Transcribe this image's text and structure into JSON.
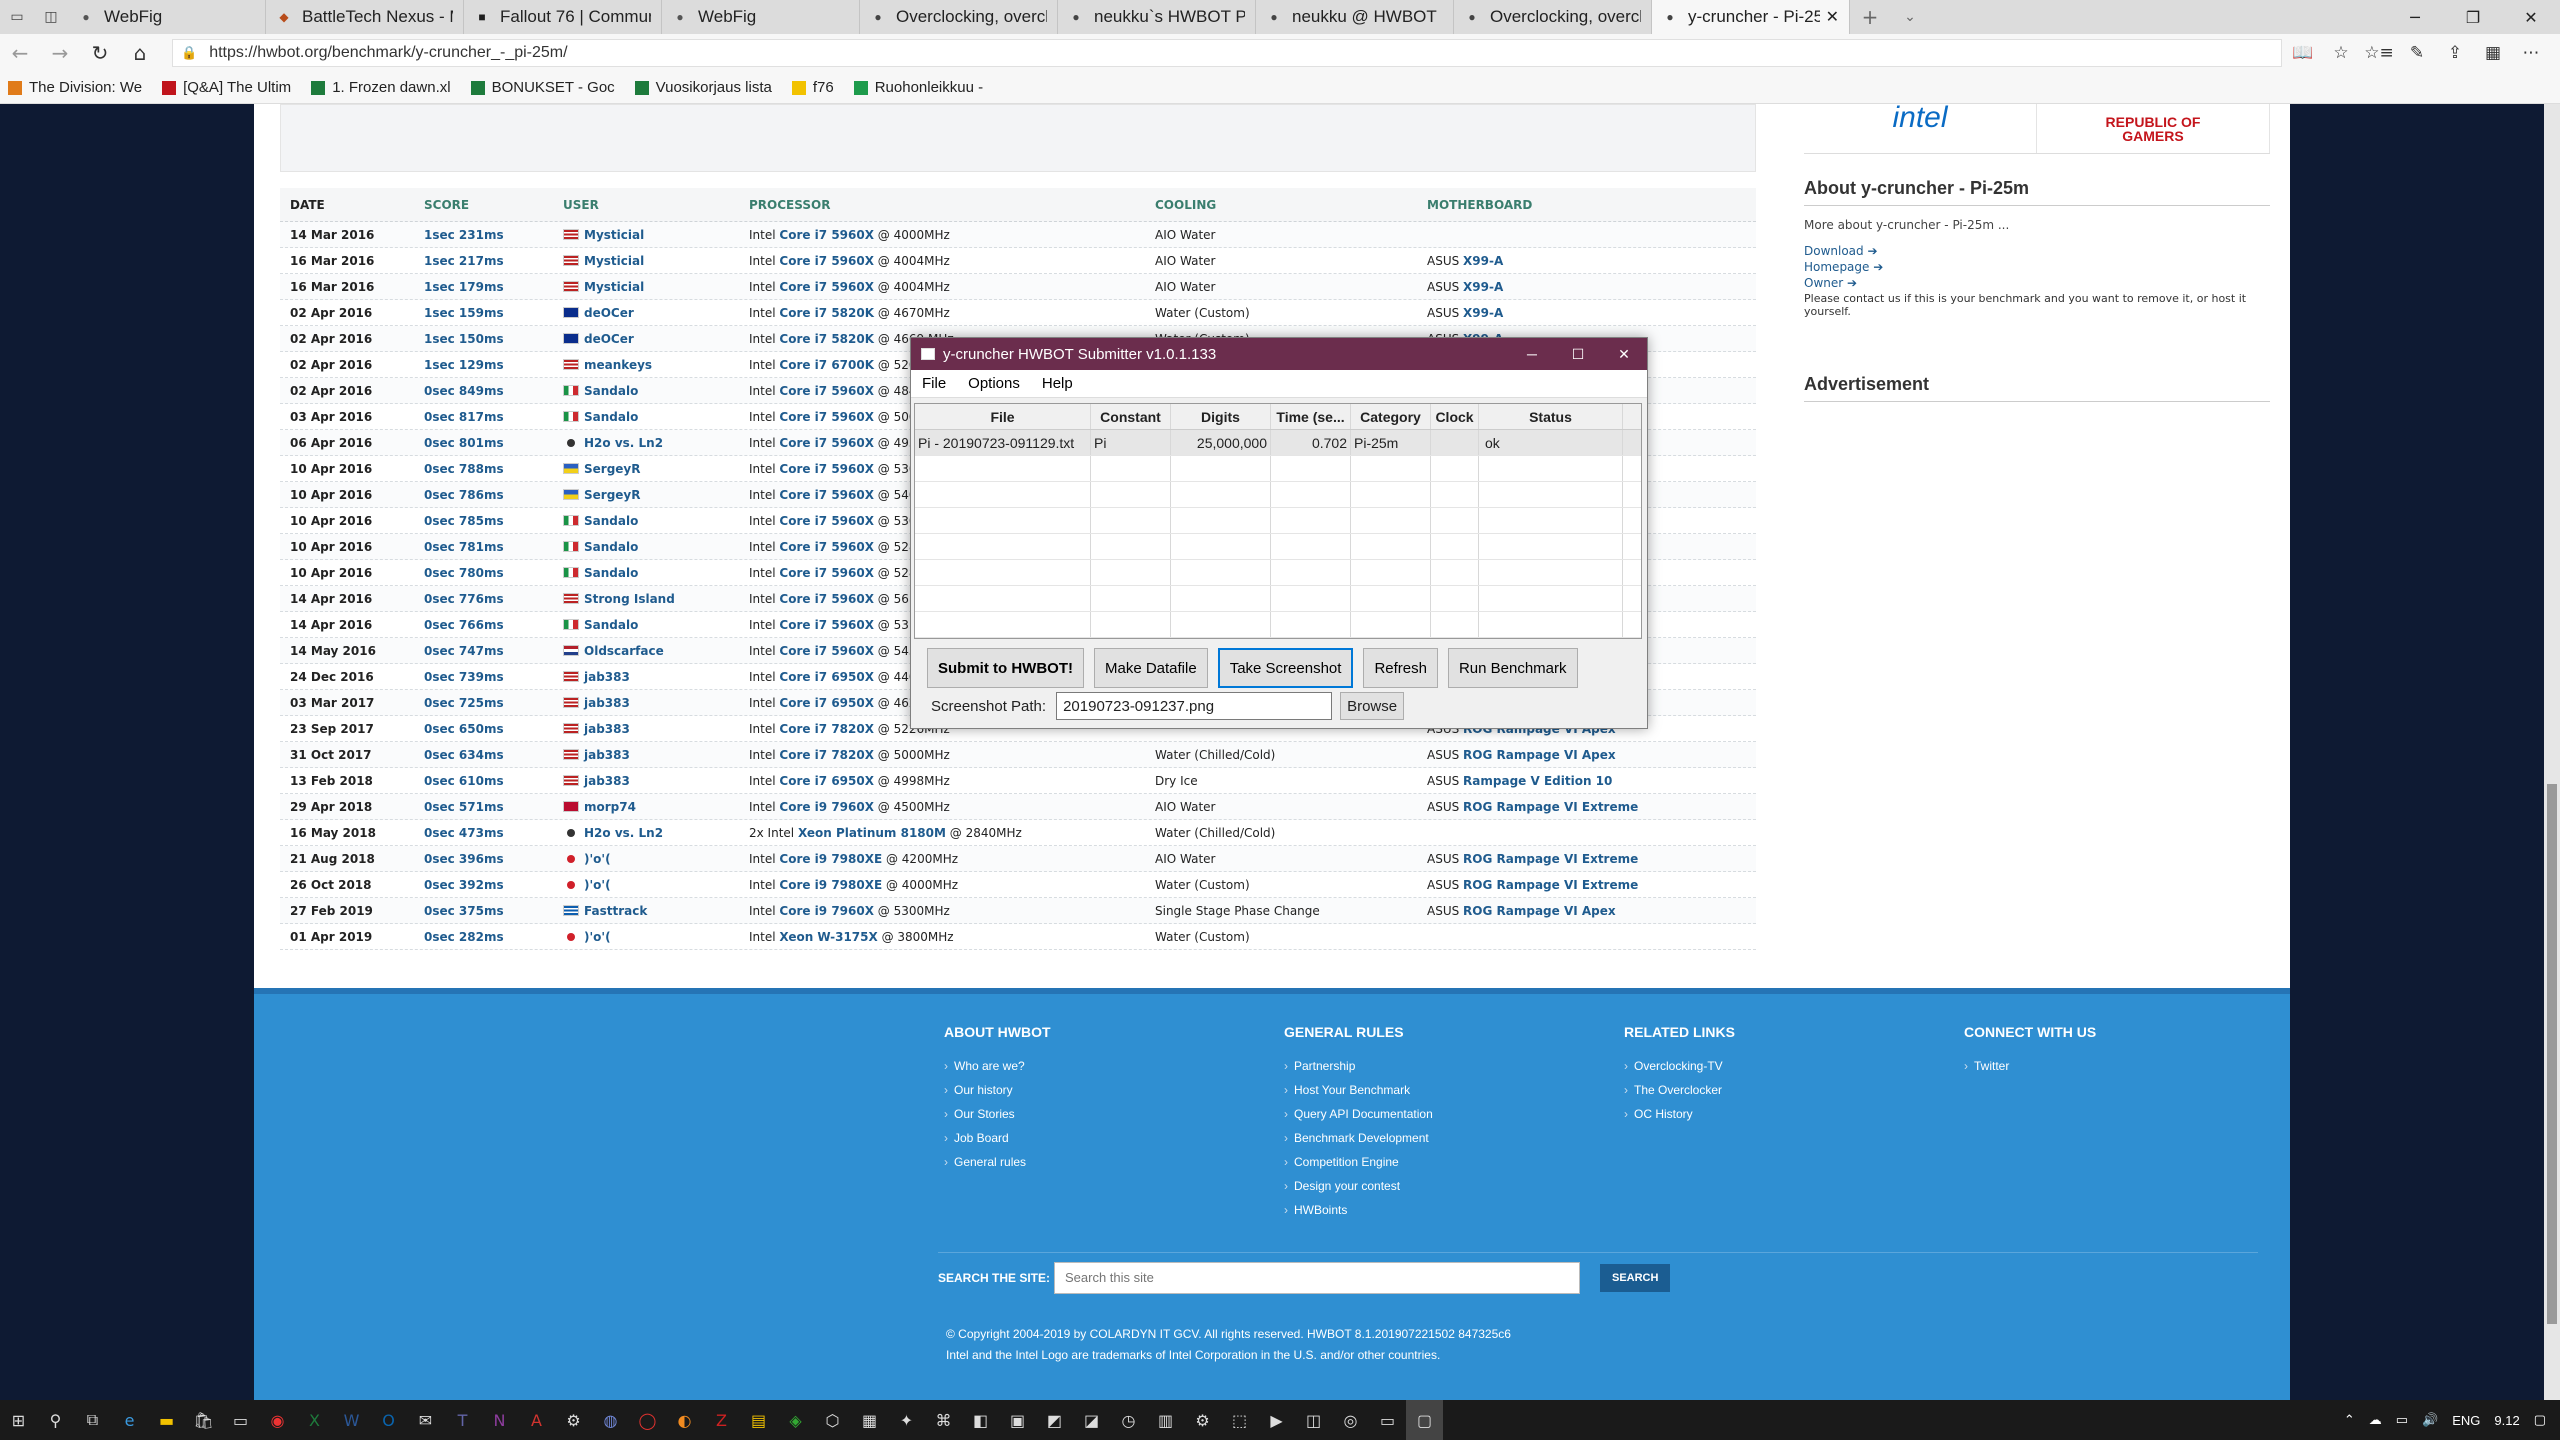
{
  "browser": {
    "tabs": [
      {
        "title": "WebFig",
        "icon": "webfig"
      },
      {
        "title": "BattleTech Nexus - Mo",
        "icon": "nexus"
      },
      {
        "title": "Fallout 76 | Community",
        "icon": "fallout"
      },
      {
        "title": "WebFig",
        "icon": "webfig"
      },
      {
        "title": "Overclocking, overcloc",
        "icon": "hwbot"
      },
      {
        "title": "neukku`s HWBOT Prim",
        "icon": "hwbot"
      },
      {
        "title": "neukku @ HWBOT",
        "icon": "hwbot"
      },
      {
        "title": "Overclocking, overcloc",
        "icon": "hwbot"
      },
      {
        "title": "y-cruncher - Pi-25m",
        "icon": "hwbot",
        "active": true
      }
    ],
    "url": "https://hwbot.org/benchmark/y-cruncher_-_pi-25m/",
    "favorites": [
      {
        "label": "The Division: We",
        "color": "#e07b1a"
      },
      {
        "label": "[Q&A] The Ultim",
        "color": "#c0141c"
      },
      {
        "label": "1. Frozen dawn.xl",
        "color": "#1e7b3c"
      },
      {
        "label": "BONUKSET - Goc",
        "color": "#1e7b3c"
      },
      {
        "label": "Vuosikorjaus lista",
        "color": "#1e7b3c"
      },
      {
        "label": "f76",
        "color": "#f2c200"
      },
      {
        "label": "Ruohonleikkuu -",
        "color": "#1e9b4c"
      }
    ]
  },
  "results": {
    "headers": {
      "date": "DATE",
      "score": "SCORE",
      "user": "USER",
      "processor": "PROCESSOR",
      "cooling": "COOLING",
      "motherboard": "MOTHERBOARD"
    },
    "rows": [
      {
        "date": "14 Mar 2016",
        "score": "1sec 231ms",
        "user": "Mysticial",
        "flag": "us",
        "cpu_pre": "Intel ",
        "cpu": "Core i7 5960X",
        "cpu_post": " @ 4000MHz",
        "cooling": "AIO Water",
        "mb_pre": "",
        "mb": ""
      },
      {
        "date": "16 Mar 2016",
        "score": "1sec 217ms",
        "user": "Mysticial",
        "flag": "us",
        "cpu_pre": "Intel ",
        "cpu": "Core i7 5960X",
        "cpu_post": " @ 4004MHz",
        "cooling": "AIO Water",
        "mb_pre": "ASUS ",
        "mb": "X99-A"
      },
      {
        "date": "16 Mar 2016",
        "score": "1sec 179ms",
        "user": "Mysticial",
        "flag": "us",
        "cpu_pre": "Intel ",
        "cpu": "Core i7 5960X",
        "cpu_post": " @ 4004MHz",
        "cooling": "AIO Water",
        "mb_pre": "ASUS ",
        "mb": "X99-A"
      },
      {
        "date": "02 Apr 2016",
        "score": "1sec 159ms",
        "user": "deOCer",
        "flag": "eu",
        "cpu_pre": "Intel ",
        "cpu": "Core i7 5820K",
        "cpu_post": " @ 4670MHz",
        "cooling": "Water (Custom)",
        "mb_pre": "ASUS ",
        "mb": "X99-A"
      },
      {
        "date": "02 Apr 2016",
        "score": "1sec 150ms",
        "user": "deOCer",
        "flag": "eu",
        "cpu_pre": "Intel ",
        "cpu": "Core i7 5820K",
        "cpu_post": " @ 4669 MHz",
        "cooling": "Water (Custom)",
        "mb_pre": "ASUS ",
        "mb": "X99-A"
      },
      {
        "date": "02 Apr 2016",
        "score": "1sec 129ms",
        "user": "meankeys",
        "flag": "us",
        "cpu_pre": "Intel ",
        "cpu": "Core i7 6700K",
        "cpu_post": " @ 5200MHz",
        "cooling": "",
        "mb_pre": "",
        "mb": ""
      },
      {
        "date": "02 Apr 2016",
        "score": "0sec 849ms",
        "user": "Sandalo",
        "flag": "it",
        "cpu_pre": "Intel ",
        "cpu": "Core i7 5960X",
        "cpu_post": " @ 4840MHz",
        "cooling": "",
        "mb_pre": "",
        "mb": ""
      },
      {
        "date": "03 Apr 2016",
        "score": "0sec 817ms",
        "user": "Sandalo",
        "flag": "it",
        "cpu_pre": "Intel ",
        "cpu": "Core i7 5960X",
        "cpu_post": " @ 5001MHz",
        "cooling": "",
        "mb_pre": "",
        "mb": ""
      },
      {
        "date": "06 Apr 2016",
        "score": "0sec 801ms",
        "user": "H2o vs. Ln2",
        "flag": "team",
        "cpu_pre": "Intel ",
        "cpu": "Core i7 5960X",
        "cpu_post": " @ 4933.",
        "cooling": "",
        "mb_pre": "",
        "mb": ""
      },
      {
        "date": "10 Apr 2016",
        "score": "0sec 788ms",
        "user": "SergeyR",
        "flag": "ua",
        "cpu_pre": "Intel ",
        "cpu": "Core i7 5960X",
        "cpu_post": " @ 5300MHz",
        "cooling": "",
        "mb_pre": "",
        "mb": ""
      },
      {
        "date": "10 Apr 2016",
        "score": "0sec 786ms",
        "user": "SergeyR",
        "flag": "ua",
        "cpu_pre": "Intel ",
        "cpu": "Core i7 5960X",
        "cpu_post": " @ 5400MHz",
        "cooling": "",
        "mb_pre": "",
        "mb": ""
      },
      {
        "date": "10 Apr 2016",
        "score": "0sec 785ms",
        "user": "Sandalo",
        "flag": "it",
        "cpu_pre": "Intel ",
        "cpu": "Core i7 5960X",
        "cpu_post": " @ 5300MHz",
        "cooling": "",
        "mb_pre": "",
        "mb": ""
      },
      {
        "date": "10 Apr 2016",
        "score": "0sec 781ms",
        "user": "Sandalo",
        "flag": "it",
        "cpu_pre": "Intel ",
        "cpu": "Core i7 5960X",
        "cpu_post": " @ 5280MHz",
        "cooling": "",
        "mb_pre": "",
        "mb": ""
      },
      {
        "date": "10 Apr 2016",
        "score": "0sec 780ms",
        "user": "Sandalo",
        "flag": "it",
        "cpu_pre": "Intel ",
        "cpu": "Core i7 5960X",
        "cpu_post": " @ 5280MHz",
        "cooling": "",
        "mb_pre": "",
        "mb": ""
      },
      {
        "date": "14 Apr 2016",
        "score": "0sec 776ms",
        "user": "Strong Island",
        "flag": "us",
        "cpu_pre": "Intel ",
        "cpu": "Core i7 5960X",
        "cpu_post": " @ 5610.",
        "cooling": "",
        "mb_pre": "",
        "mb": ""
      },
      {
        "date": "14 Apr 2016",
        "score": "0sec 766ms",
        "user": "Sandalo",
        "flag": "it",
        "cpu_pre": "Intel ",
        "cpu": "Core i7 5960X",
        "cpu_post": " @ 5310MHz",
        "cooling": "",
        "mb_pre": "",
        "mb": ""
      },
      {
        "date": "14 May 2016",
        "score": "0sec 747ms",
        "user": "Oldscarface",
        "flag": "nl",
        "cpu_pre": "Intel ",
        "cpu": "Core i7 5960X",
        "cpu_post": " @ 5432MHz",
        "cooling": "",
        "mb_pre": "",
        "mb": ""
      },
      {
        "date": "24 Dec 2016",
        "score": "0sec 739ms",
        "user": "jab383",
        "flag": "us",
        "cpu_pre": "Intel ",
        "cpu": "Core i7 6950X",
        "cpu_post": " @ 4400MHz",
        "cooling": "",
        "mb_pre": "",
        "mb": ""
      },
      {
        "date": "03 Mar 2017",
        "score": "0sec 725ms",
        "user": "jab383",
        "flag": "us",
        "cpu_pre": "Intel ",
        "cpu": "Core i7 6950X",
        "cpu_post": " @ 4623MHz",
        "cooling": "",
        "mb_pre": "",
        "mb": ""
      },
      {
        "date": "23 Sep 2017",
        "score": "0sec 650ms",
        "user": "jab383",
        "flag": "us",
        "cpu_pre": "Intel ",
        "cpu": "Core i7 7820X",
        "cpu_post": " @ 5226MHz",
        "cooling": "",
        "mb_pre": "ASUS ",
        "mb": "ROG Rampage VI Apex"
      },
      {
        "date": "31 Oct 2017",
        "score": "0sec 634ms",
        "user": "jab383",
        "flag": "us",
        "cpu_pre": "Intel ",
        "cpu": "Core i7 7820X",
        "cpu_post": " @ 5000MHz",
        "cooling": "Water (Chilled/Cold)",
        "mb_pre": "ASUS ",
        "mb": "ROG Rampage VI Apex"
      },
      {
        "date": "13 Feb 2018",
        "score": "0sec 610ms",
        "user": "jab383",
        "flag": "us",
        "cpu_pre": "Intel ",
        "cpu": "Core i7 6950X",
        "cpu_post": " @ 4998MHz",
        "cooling": "Dry Ice",
        "mb_pre": "ASUS ",
        "mb": "Rampage V Edition 10"
      },
      {
        "date": "29 Apr 2018",
        "score": "0sec 571ms",
        "user": "morp74",
        "flag": "no",
        "cpu_pre": "Intel ",
        "cpu": "Core i9 7960X",
        "cpu_post": " @ 4500MHz",
        "cooling": "AIO Water",
        "mb_pre": "ASUS ",
        "mb": "ROG Rampage VI Extreme"
      },
      {
        "date": "16 May 2018",
        "score": "0sec 473ms",
        "user": "H2o vs. Ln2",
        "flag": "team",
        "cpu_pre": "2x Intel ",
        "cpu": "Xeon Platinum 8180M",
        "cpu_post": " @ 2840MHz",
        "cooling": "Water (Chilled/Cold)",
        "mb_pre": "",
        "mb": ""
      },
      {
        "date": "21 Aug 2018",
        "score": "0sec 396ms",
        "user": ")'o'(",
        "flag": "jp",
        "cpu_pre": "Intel ",
        "cpu": "Core i9 7980XE",
        "cpu_post": " @ 4200MHz",
        "cooling": "AIO Water",
        "mb_pre": "ASUS ",
        "mb": "ROG Rampage VI Extreme"
      },
      {
        "date": "26 Oct 2018",
        "score": "0sec 392ms",
        "user": ")'o'(",
        "flag": "jp",
        "cpu_pre": "Intel ",
        "cpu": "Core i9 7980XE",
        "cpu_post": " @ 4000MHz",
        "cooling": "Water (Custom)",
        "mb_pre": "ASUS ",
        "mb": "ROG Rampage VI Extreme"
      },
      {
        "date": "27 Feb 2019",
        "score": "0sec 375ms",
        "user": "Fasttrack",
        "flag": "gr",
        "cpu_pre": "Intel ",
        "cpu": "Core i9 7960X",
        "cpu_post": " @ 5300MHz",
        "cooling": "Single Stage Phase Change",
        "mb_pre": "ASUS ",
        "mb": "ROG Rampage VI Apex"
      },
      {
        "date": "01 Apr 2019",
        "score": "0sec 282ms",
        "user": ")'o'(",
        "flag": "jp",
        "cpu_pre": "Intel ",
        "cpu": "Xeon W-3175X",
        "cpu_post": " @ 3800MHz",
        "cooling": "Water (Custom)",
        "mb_pre": "",
        "mb": ""
      }
    ]
  },
  "sidebar": {
    "intel_logo": "intel",
    "rog_logo_line1": "REPUBLIC OF",
    "rog_logo_line2": "GAMERS",
    "about_title": "About y-cruncher - Pi-25m",
    "about_text": "More about y-cruncher - Pi-25m ...",
    "links": [
      "Download ➔",
      "Homepage ➔",
      "Owner ➔"
    ],
    "contact": "Please contact us if this is your benchmark and you want to remove it, or host it yourself.",
    "ad_title": "Advertisement"
  },
  "footer": {
    "col1": {
      "title": "ABOUT HWBOT",
      "items": [
        "Who are we?",
        "Our history",
        "Our Stories",
        "Job Board",
        "General rules"
      ]
    },
    "col2": {
      "title": "GENERAL RULES",
      "items": [
        "Partnership",
        "Host Your Benchmark",
        "Query API Documentation",
        "Benchmark Development",
        "Competition Engine",
        "Design your contest",
        "HWBoints"
      ]
    },
    "col3": {
      "title": "RELATED LINKS",
      "items": [
        "Overclocking-TV",
        "The Overclocker",
        "OC History"
      ]
    },
    "col4": {
      "title": "CONNECT WITH US",
      "items": [
        "Twitter"
      ]
    },
    "search_label": "SEARCH THE SITE:",
    "search_placeholder": "Search this site",
    "search_button": "SEARCH",
    "copyright": "© Copyright 2004-2019 by COLARDYN IT GCV. All rights reserved. HWBOT 8.1.201907221502 847325c6",
    "trademark": "Intel and the Intel Logo are trademarks of Intel Corporation in the U.S. and/or other countries."
  },
  "dialog": {
    "title": "y-cruncher HWBOT Submitter v1.0.1.133",
    "menu": [
      "File",
      "Options",
      "Help"
    ],
    "columns": [
      "File",
      "Constant",
      "Digits",
      "Time (se...",
      "Category",
      "Clock",
      "Status"
    ],
    "row": {
      "file": "Pi - 20190723-091129.txt",
      "constant": "Pi",
      "digits": "25,000,000",
      "time": "0.702",
      "category": "Pi-25m",
      "clock": "",
      "status": "ok"
    },
    "buttons": [
      "Submit to HWBOT!",
      "Make Datafile",
      "Take Screenshot",
      "Refresh",
      "Run Benchmark"
    ],
    "screenshot_label": "Screenshot Path:",
    "screenshot_path": "20190723-091237.png",
    "browse_label": "Browse"
  },
  "taskbar": {
    "lang": "ENG",
    "time": "9.12"
  },
  "colors": {
    "accent": "#2f8fd2",
    "dialog_title": "#6b2d4d",
    "link": "#1f5b8e"
  }
}
